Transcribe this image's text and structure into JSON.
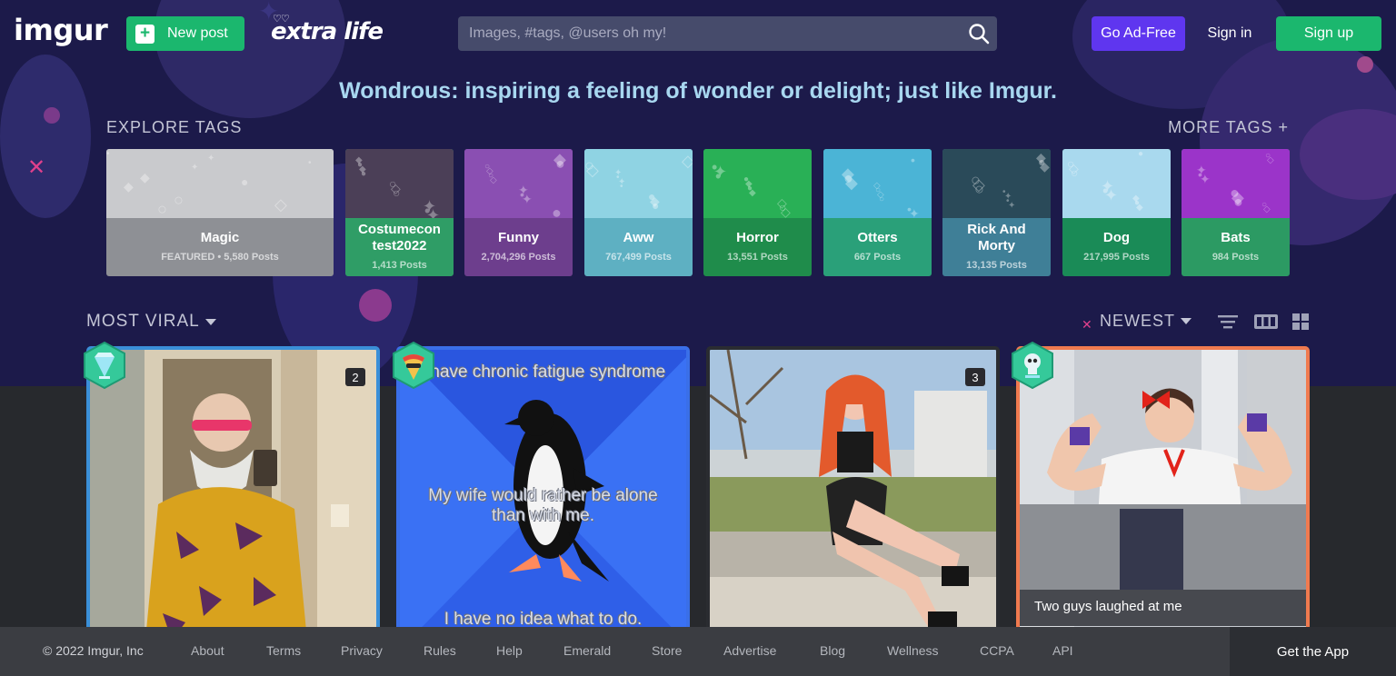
{
  "header": {
    "logo": "imgur",
    "new_post": "New post",
    "extralife": "extra life",
    "extralife_mark": "♡♡",
    "search_placeholder": "Images, #tags, @users oh my!",
    "go_adfree": "Go Ad-Free",
    "sign_in": "Sign in",
    "sign_up": "Sign up"
  },
  "tagline": "Wondrous: inspiring a feeling of wonder or delight; just like Imgur.",
  "explore": {
    "title": "EXPLORE TAGS",
    "more": "MORE TAGS +",
    "tags": [
      {
        "name": "Magic",
        "count": "FEATURED • 5,580 Posts",
        "color": "#8e9095",
        "pattern_color": "#c9cacd"
      },
      {
        "name": "Costumecon test2022",
        "count": "1,413 Posts",
        "color": "#2f9d66",
        "pattern_color": "#4b3f57"
      },
      {
        "name": "Funny",
        "count": "2,704,296 Posts",
        "color": "#6d3e8d",
        "pattern_color": "#8a4fb2"
      },
      {
        "name": "Aww",
        "count": "767,499 Posts",
        "color": "#5eb0c2",
        "pattern_color": "#8fd3e3"
      },
      {
        "name": "Horror",
        "count": "13,551 Posts",
        "color": "#1f8c4b",
        "pattern_color": "#29b056"
      },
      {
        "name": "Otters",
        "count": "667 Posts",
        "color": "#2aa079",
        "pattern_color": "#4bb4d6"
      },
      {
        "name": "Rick And Morty",
        "count": "13,135 Posts",
        "color": "#3f7f97",
        "pattern_color": "#2a4a59"
      },
      {
        "name": "Dog",
        "count": "217,995 Posts",
        "color": "#1a8b57",
        "pattern_color": "#a9d9ee"
      },
      {
        "name": "Bats",
        "count": "984 Posts",
        "color": "#2c9a63",
        "pattern_color": "#9b34c9"
      }
    ]
  },
  "feed": {
    "most_viral": "MOST VIRAL",
    "sort": "NEWEST",
    "posts": [
      {
        "count": "2",
        "border": "#3a8fd8"
      },
      {
        "top_text": "I have chronic fatigue syndrome",
        "mid_text": "My wife would rather be alone than with me.",
        "bottom_text": "I have no idea what to do.",
        "border": "#3a6fe8"
      },
      {
        "count": "3",
        "border": "#2a2c31"
      },
      {
        "caption": "Two guys laughed at me",
        "border": "#f07a4f"
      }
    ]
  },
  "footer": {
    "copyright": "© 2022 Imgur, Inc",
    "links": [
      "About",
      "Terms",
      "Privacy",
      "Rules",
      "Help",
      "Emerald",
      "Store",
      "Advertise",
      "Blog",
      "Wellness",
      "CCPA",
      "API"
    ],
    "get_app": "Get the App"
  }
}
